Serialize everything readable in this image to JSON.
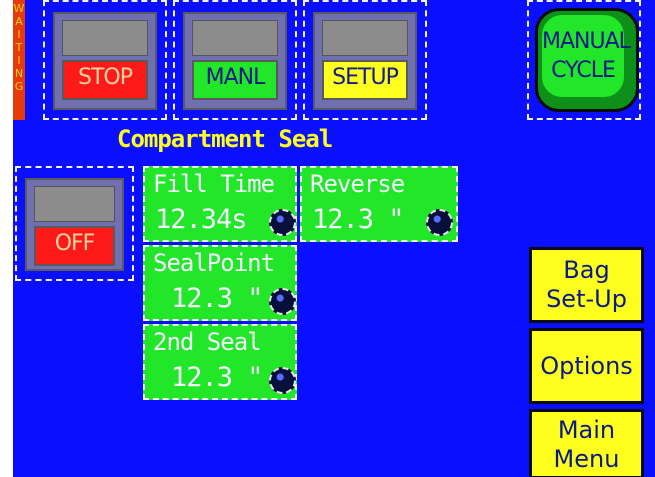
{
  "status": {
    "waiting_label": "WAITING"
  },
  "mode_buttons": [
    {
      "label": "STOP"
    },
    {
      "label": "MANL"
    },
    {
      "label": "SETUP"
    }
  ],
  "manual_cycle": {
    "line1": "MANUAL",
    "line2": "CYCLE"
  },
  "section_title": "Compartment Seal",
  "off_button": {
    "label": "OFF"
  },
  "settings": {
    "fill_time": {
      "label": "Fill Time",
      "value": "12.34s"
    },
    "reverse": {
      "label": "Reverse",
      "value": "12.3 \""
    },
    "seal_point": {
      "label": "SealPoint",
      "value": "12.3 \""
    },
    "second_seal": {
      "label": "2nd Seal",
      "value": "12.3 \""
    }
  },
  "side_menu": {
    "bag_setup": {
      "line1": "Bag",
      "line2": "Set-Up"
    },
    "options": {
      "label": "Options"
    },
    "main_menu": {
      "line1": "Main",
      "line2": "Menu"
    }
  },
  "colors": {
    "background": "#0a10ff",
    "green": "#22e628",
    "yellow": "#ffff1e",
    "red": "#ff1a1a"
  }
}
